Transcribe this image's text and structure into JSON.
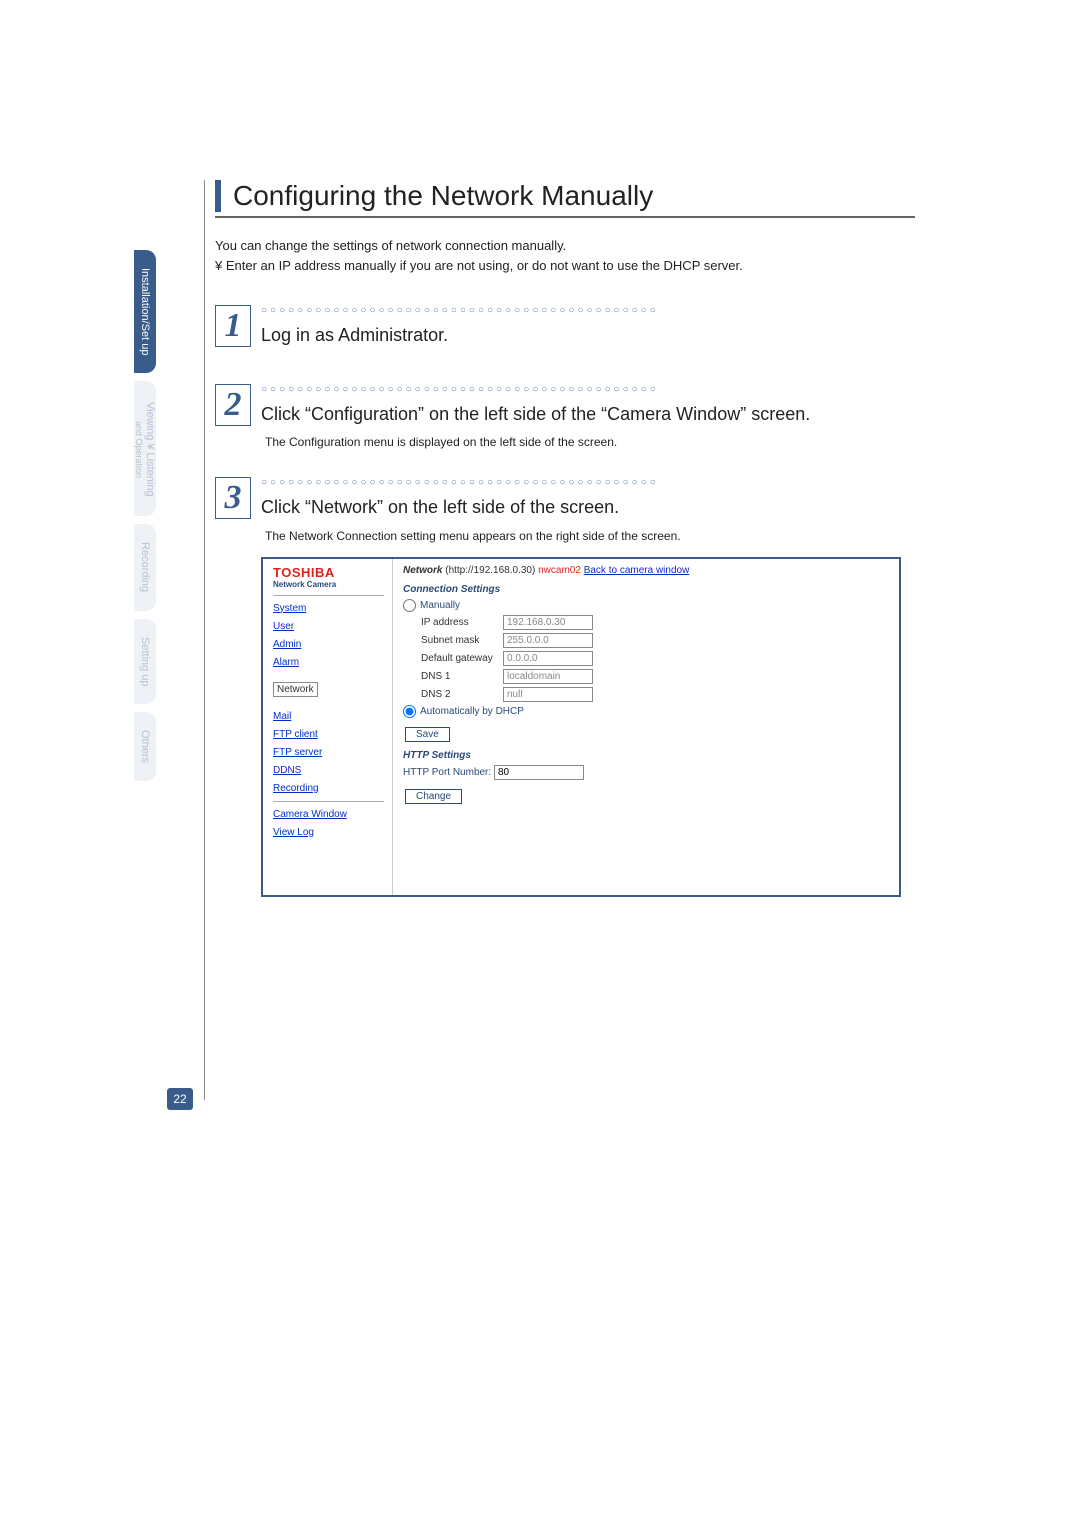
{
  "page_number": "22",
  "tabs": {
    "installation": "Installation/Set up",
    "viewing": "Viewing ¥ Listening",
    "viewing_sub": "and Operation",
    "recording": "Recording",
    "setting": "Setting up",
    "others": "Others"
  },
  "title": "Configuring the Network Manually",
  "intro_line1": "You can change the settings of network connection manually.",
  "intro_line2": "¥ Enter an IP address manually if you are not using, or do not want to use the DHCP server.",
  "step1": {
    "num": "1",
    "heading": "Log in as Administrator."
  },
  "step2": {
    "num": "2",
    "heading": "Click “Configuration” on the left side of the “Camera Window” screen.",
    "sub": "The Configuration menu is displayed on the left side of the screen."
  },
  "step3": {
    "num": "3",
    "heading": "Click “Network” on the left side of the screen.",
    "sub": "The Network Connection setting menu appears on the right side of the screen."
  },
  "screenshot": {
    "logo": "TOSHIBA",
    "logo_sub": "Network Camera",
    "sidebar": {
      "system": "System",
      "user": "User",
      "admin": "Admin",
      "alarm": "Alarm",
      "network": "Network",
      "mail": "Mail",
      "ftp_client": "FTP client",
      "ftp_server": "FTP server",
      "ddns": "DDNS",
      "recording": "Recording",
      "camera_window": "Camera Window",
      "view_log": "View Log"
    },
    "header": {
      "label": "Network",
      "url": "(http://192.168.0.30)",
      "cam": "nwcam02",
      "back": "Back to camera window"
    },
    "connection": {
      "title": "Connection Settings",
      "manually": "Manually",
      "ip_label": "IP address",
      "ip_value": "192.168.0.30",
      "subnet_label": "Subnet mask",
      "subnet_value": "255.0.0.0",
      "gateway_label": "Default gateway",
      "gateway_value": "0.0.0.0",
      "dns1_label": "DNS 1",
      "dns1_value": "localdomain",
      "dns2_label": "DNS 2",
      "dns2_value": "null",
      "dhcp": "Automatically by DHCP",
      "save": "Save"
    },
    "http": {
      "title": "HTTP Settings",
      "port_label": "HTTP Port Number:",
      "port_value": "80",
      "change": "Change"
    }
  }
}
